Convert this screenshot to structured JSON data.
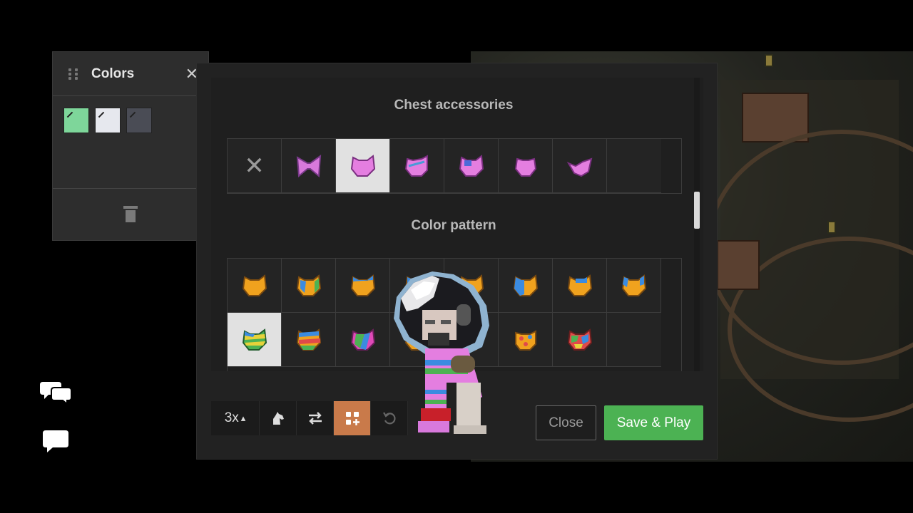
{
  "colors_panel": {
    "title": "Colors",
    "close_symbol": "✕",
    "swatches": [
      "#7ed69a",
      "#e6e8ee",
      "#4a4c55"
    ]
  },
  "modal": {
    "sections": [
      {
        "title": "Chest accessories",
        "none_symbol": "✕",
        "selected_index": 2
      },
      {
        "title": "Color pattern",
        "selected_index": 8
      }
    ],
    "toolbar": {
      "zoom_label": "3x",
      "zoom_caret": "▴"
    },
    "close_label": "Close",
    "save_label": "Save & Play"
  },
  "icons": {
    "drag": "drag-handle-icon",
    "trash": "trash-icon",
    "horse": "horse-icon",
    "swap": "swap-icon",
    "grid_add": "grid-add-icon",
    "undo": "undo-icon",
    "chat_multi": "chat-bubbles-icon",
    "chat_single": "chat-bubble-icon"
  },
  "accent_colors": {
    "active_tool": "#c97a4a",
    "save": "#4cb253",
    "accessory": "#e47ee0",
    "pattern": "#f0a21e"
  }
}
